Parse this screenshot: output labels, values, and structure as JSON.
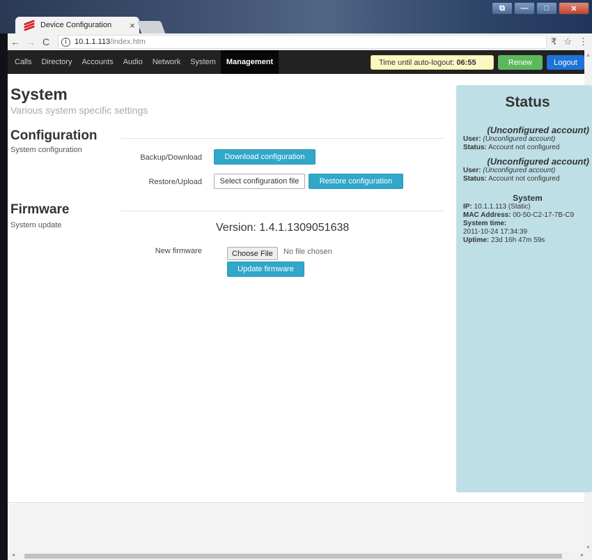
{
  "browser": {
    "tab_title": "Device Configuration",
    "tab_close": "×",
    "url_host": "10.1.1.113",
    "url_path": "/index.htm"
  },
  "nav": {
    "items": [
      "Calls",
      "Directory",
      "Accounts",
      "Audio",
      "Network",
      "System"
    ],
    "active": "Management",
    "autologout_label": "Time until auto-logout:",
    "autologout_time": "06:55",
    "renew": "Renew",
    "logout": "Logout"
  },
  "page": {
    "title": "System",
    "subtitle": "Various system specific settings",
    "configuration": {
      "heading": "Configuration",
      "subheading": "System configuration",
      "backup_label": "Backup/Download",
      "download_button": "Download configuration",
      "restore_label": "Restore/Upload",
      "select_file": "Select configuration file",
      "restore_button": "Restore configuration"
    },
    "firmware": {
      "heading": "Firmware",
      "subheading": "System update",
      "version": "Version: 1.4.1.1309051638",
      "new_label": "New firmware",
      "choose_file": "Choose File",
      "no_file": "No file chosen",
      "update_button": "Update firmware"
    }
  },
  "status": {
    "title": "Status",
    "accounts": [
      {
        "title": "(Unconfigured account)",
        "user_label": "User:",
        "user_value": "(Unconfigured account)",
        "status_label": "Status:",
        "status_value": "Account not configured"
      },
      {
        "title": "(Unconfigured account)",
        "user_label": "User:",
        "user_value": "(Unconfigured account)",
        "status_label": "Status:",
        "status_value": "Account not configured"
      }
    ],
    "system": {
      "title": "System",
      "ip_label": "IP:",
      "ip_value": "10.1.1.113 (Static)",
      "mac_label": "MAC Address:",
      "mac_value": "00-50-C2-17-7B-C9",
      "time_label": "System time:",
      "time_value": "2011-10-24 17:34:39",
      "uptime_label": "Uptime:",
      "uptime_value": "23d 16h 47m 59s"
    }
  }
}
